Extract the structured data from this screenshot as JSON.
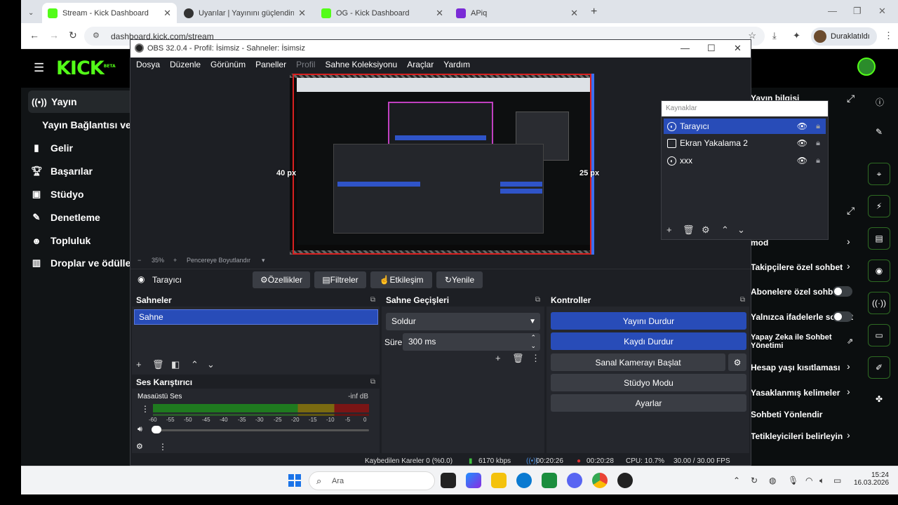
{
  "browser": {
    "tabs": [
      {
        "label": "Stream - Kick Dashboard",
        "color": "#53fc18"
      },
      {
        "label": "Uyarılar | Yayınını güçlendirmek",
        "color": "#333333"
      },
      {
        "label": "OG - Kick Dashboard",
        "color": "#53fc18"
      },
      {
        "label": "APiq",
        "color": "#7a2bd6"
      }
    ],
    "url": "dashboard.kick.com/stream",
    "profile_label": "Duraklatıldı"
  },
  "kick": {
    "logo": "KICK",
    "logo_sup": "BETA",
    "sidebar": [
      {
        "icon": "broadcast-icon",
        "label": "Yayın"
      },
      {
        "icon": "",
        "label": "Yayın Bağlantısı ve Anahtarı"
      },
      {
        "icon": "chart-icon",
        "label": "Gelir"
      },
      {
        "icon": "trophy-icon",
        "label": "Başarılar"
      },
      {
        "icon": "camera-icon",
        "label": "Stüdyo"
      },
      {
        "icon": "wrench-icon",
        "label": "Denetleme"
      },
      {
        "icon": "people-icon",
        "label": "Topluluk"
      },
      {
        "icon": "gift-icon",
        "label": "Droplar ve ödüller"
      }
    ],
    "right_panel": [
      "Yayın bilgisi",
      "mod",
      "Takipçilere özel sohbet",
      "Abonelere özel sohbet",
      "Yalnızca ifadelerle sohbet",
      "Yapay Zeka ile Sohbet Yönetimi",
      "Hesap yaşı kısıtlaması",
      "Yasaklanmış kelimeler",
      "Sohbeti Yönlendir",
      "Tetikleyicileri belirleyin"
    ]
  },
  "obs": {
    "title": "OBS 32.0.4 - Profil: İsimsiz - Sahneler: İsimsiz",
    "menu": [
      "Dosya",
      "Düzenle",
      "Görünüm",
      "Paneller",
      "Profil",
      "Sahne Koleksiyonu",
      "Araçlar",
      "Yardım"
    ],
    "preview": {
      "left_px": "40 px",
      "right_px": "25 px",
      "zoom": "35%",
      "fit_label": "Pencereye Boyutlandır"
    },
    "source_toolbar": {
      "selected": "Tarayıcı",
      "buttons": [
        "Özellikler",
        "Filtreler",
        "Etkileşim",
        "Yenile"
      ]
    },
    "scenes": {
      "title": "Sahneler",
      "items": [
        "Sahne"
      ]
    },
    "transitions": {
      "title": "Sahne Geçişleri",
      "transition": "Soldur",
      "duration_label": "Süre",
      "duration": "300 ms"
    },
    "controls": {
      "title": "Kontroller",
      "buttons": [
        "Yayını Durdur",
        "Kaydı Durdur",
        "Sanal Kamerayı Başlat",
        "Stüdyo Modu",
        "Ayarlar"
      ]
    },
    "mixer": {
      "title": "Ses Karıştırıcı",
      "channel": "Masaüstü Ses",
      "level": "-inf dB",
      "scale": [
        "-60",
        "-55",
        "-50",
        "-45",
        "-40",
        "-35",
        "-30",
        "-25",
        "-20",
        "-15",
        "-10",
        "-5",
        "0"
      ]
    },
    "sources": {
      "title": "Kaynaklar",
      "items": [
        {
          "name": "Tarayıcı",
          "icon": "globe-icon"
        },
        {
          "name": "Ekran Yakalama 2",
          "icon": "monitor-icon"
        },
        {
          "name": "xxx",
          "icon": "globe-icon"
        }
      ]
    },
    "status": {
      "dropped": "Kaybedilen Kareler 0 (%0.0)",
      "bitrate": "6170 kbps",
      "stream_time": "00:20:26",
      "rec_time": "00:20:28",
      "cpu": "CPU: 10.7%",
      "fps": "30.00 / 30.00 FPS"
    }
  },
  "taskbar": {
    "search_placeholder": "Ara",
    "time": "15:24",
    "date": "16.03.2026"
  }
}
